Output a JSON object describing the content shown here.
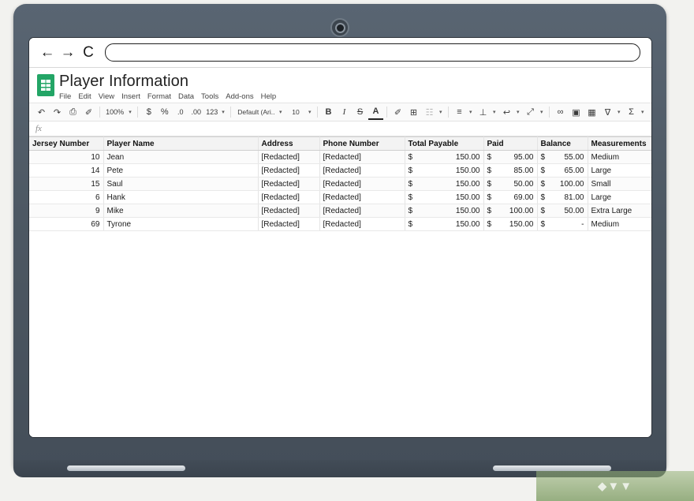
{
  "browser": {
    "back_icon": "arrow-left-icon",
    "forward_icon": "arrow-right-icon",
    "reload_icon": "reload-icon",
    "back_glyph": "←",
    "forward_glyph": "→",
    "reload_glyph": "C",
    "url_value": "",
    "url_placeholder": ""
  },
  "app": {
    "doc_title": "Player Information",
    "app_icon": "google-sheets-icon",
    "menu": [
      {
        "label": "File"
      },
      {
        "label": "Edit"
      },
      {
        "label": "View"
      },
      {
        "label": "Insert"
      },
      {
        "label": "Format"
      },
      {
        "label": "Data"
      },
      {
        "label": "Tools"
      },
      {
        "label": "Add-ons"
      },
      {
        "label": "Help"
      }
    ],
    "formula_bar": {
      "fx_label": "fx",
      "value": ""
    }
  },
  "toolbar": {
    "undo": "↶",
    "redo": "↷",
    "print": "⎙",
    "paint_format": "✐",
    "zoom_value": "100%",
    "currency": "$",
    "percent": "%",
    "decimal_decrease": ".0",
    "decimal_increase": ".00",
    "number_format": "123",
    "font_name": "Default (Ari..",
    "font_size": "10",
    "bold": "B",
    "italic": "I",
    "strikethrough": "S",
    "text_color": "A",
    "fill_color": "✐",
    "borders": "⊞",
    "merge_cells": "☷",
    "horizontal_align": "≡",
    "vertical_align": "⊥",
    "text_wrap": "↩",
    "text_rotation": "⤢",
    "insert_link": "∞",
    "insert_comment": "▣",
    "insert_chart": "▦",
    "filter": "∇",
    "functions": "Σ",
    "caret": "▾"
  },
  "sheet": {
    "columns": [
      {
        "key": "jersey",
        "label": "Jersey Number",
        "align": "num"
      },
      {
        "key": "name",
        "label": "Player Name",
        "align": "text"
      },
      {
        "key": "address",
        "label": "Address",
        "align": "text"
      },
      {
        "key": "phone",
        "label": "Phone Number",
        "align": "text"
      },
      {
        "key": "total",
        "label": "Total Payable",
        "align": "money"
      },
      {
        "key": "paid",
        "label": "Paid",
        "align": "money"
      },
      {
        "key": "balance",
        "label": "Balance",
        "align": "money"
      },
      {
        "key": "meas",
        "label": "Measurements",
        "align": "text"
      }
    ],
    "rows": [
      {
        "jersey": "10",
        "name": "Jean",
        "address": "[Redacted]",
        "phone": "[Redacted]",
        "total_sym": "$",
        "total": "150.00",
        "paid_sym": "$",
        "paid": "95.00",
        "balance_sym": "$",
        "balance": "55.00",
        "meas": "Medium"
      },
      {
        "jersey": "14",
        "name": "Pete",
        "address": "[Redacted]",
        "phone": "[Redacted]",
        "total_sym": "$",
        "total": "150.00",
        "paid_sym": "$",
        "paid": "85.00",
        "balance_sym": "$",
        "balance": "65.00",
        "meas": "Large"
      },
      {
        "jersey": "15",
        "name": "Saul",
        "address": "[Redacted]",
        "phone": "[Redacted]",
        "total_sym": "$",
        "total": "150.00",
        "paid_sym": "$",
        "paid": "50.00",
        "balance_sym": "$",
        "balance": "100.00",
        "meas": "Small"
      },
      {
        "jersey": "6",
        "name": "Hank",
        "address": "[Redacted]",
        "phone": "[Redacted]",
        "total_sym": "$",
        "total": "150.00",
        "paid_sym": "$",
        "paid": "69.00",
        "balance_sym": "$",
        "balance": "81.00",
        "meas": "Large"
      },
      {
        "jersey": "9",
        "name": "Mike",
        "address": "[Redacted]",
        "phone": "[Redacted]",
        "total_sym": "$",
        "total": "150.00",
        "paid_sym": "$",
        "paid": "100.00",
        "balance_sym": "$",
        "balance": "50.00",
        "meas": "Extra Large"
      },
      {
        "jersey": "69",
        "name": "Tyrone",
        "address": "[Redacted]",
        "phone": "[Redacted]",
        "total_sym": "$",
        "total": "150.00",
        "paid_sym": "$",
        "paid": "150.00",
        "balance_sym": "$",
        "balance": "-",
        "meas": "Medium"
      }
    ]
  },
  "device": {
    "type": "laptop",
    "bezel_color": "#4d5863",
    "webcam_icon": "webcam-icon"
  },
  "colors": {
    "sheets_green": "#23a566",
    "bezel": "#4d5863",
    "page_bg": "#f2f2ef"
  }
}
